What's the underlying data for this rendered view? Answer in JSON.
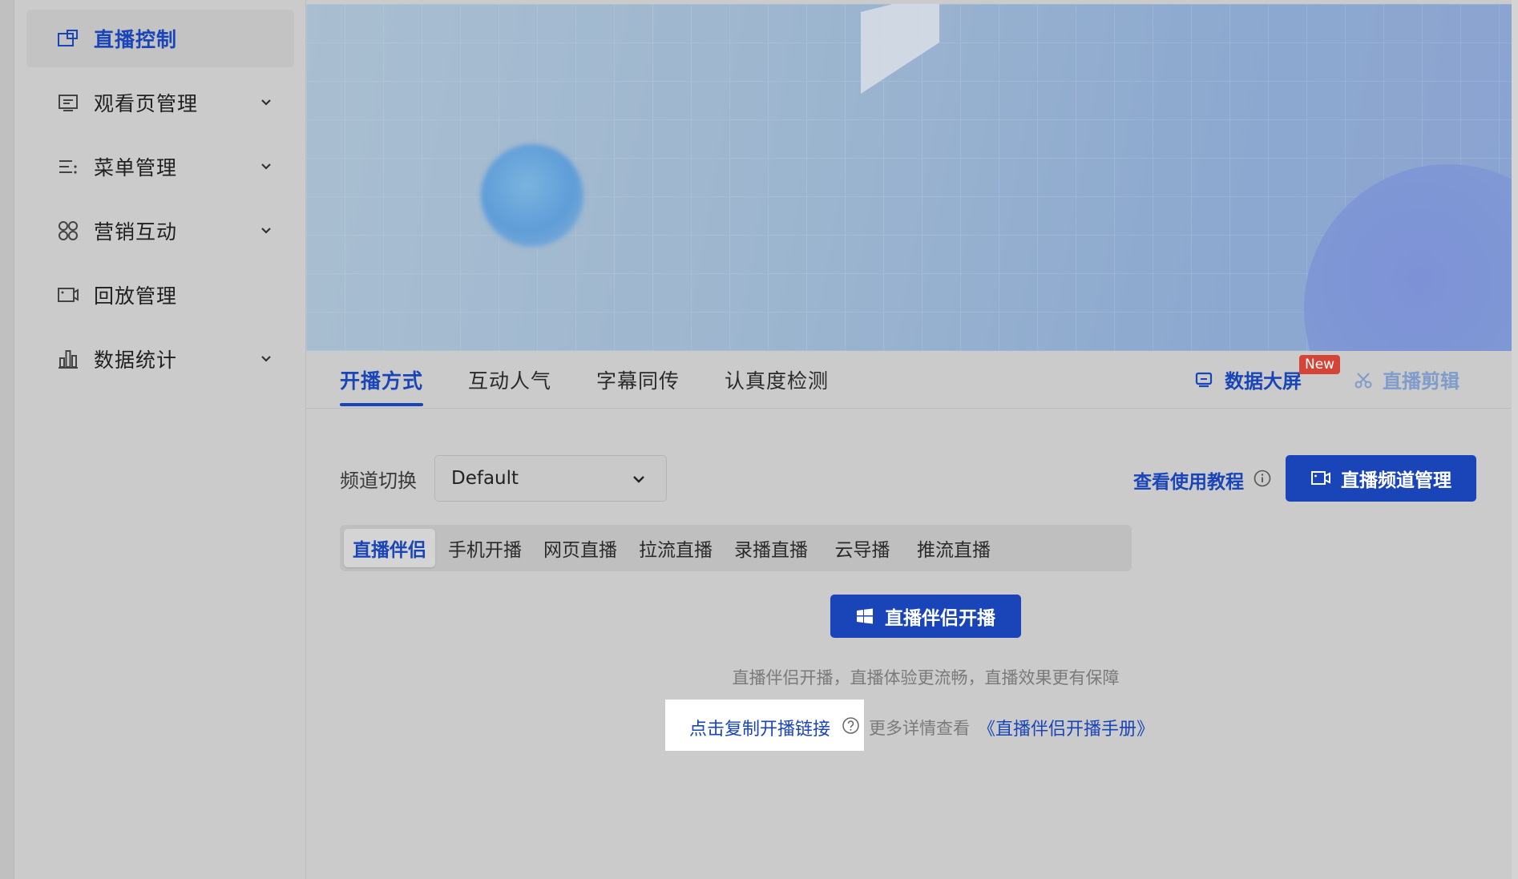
{
  "sidebar": {
    "items": [
      {
        "label": "直播控制",
        "icon": "live-control-icon",
        "active": true,
        "has_children": false
      },
      {
        "label": "观看页管理",
        "icon": "watch-page-icon",
        "active": false,
        "has_children": true
      },
      {
        "label": "菜单管理",
        "icon": "menu-icon",
        "active": false,
        "has_children": true
      },
      {
        "label": "营销互动",
        "icon": "marketing-icon",
        "active": false,
        "has_children": true
      },
      {
        "label": "回放管理",
        "icon": "replay-icon",
        "active": false,
        "has_children": false
      },
      {
        "label": "数据统计",
        "icon": "stats-icon",
        "active": false,
        "has_children": true
      }
    ]
  },
  "tabs": {
    "items": [
      "开播方式",
      "互动人气",
      "字幕同传",
      "认真度检测"
    ],
    "active_index": 0,
    "data_screen": "数据大屏",
    "new_badge": "New",
    "live_clip": "直播剪辑"
  },
  "channel": {
    "label": "频道切换",
    "selected": "Default",
    "tutorial_link": "查看使用教程",
    "manage_button": "直播频道管理"
  },
  "methods": {
    "items": [
      "直播伴侣",
      "手机开播",
      "网页直播",
      "拉流直播",
      "录播直播",
      "云导播",
      "推流直播"
    ],
    "active_index": 0
  },
  "start": {
    "button": "直播伴侣开播",
    "subtext": "直播伴侣开播，直播体验更流畅，直播效果更有保障",
    "copy_link": "点击复制开播链接",
    "more_text": "更多详情查看",
    "manual_link": "《直播伴侣开播手册》"
  },
  "colors": {
    "accent": "#1a45b8",
    "badge": "#d44537",
    "background": "#cbcbcb"
  }
}
